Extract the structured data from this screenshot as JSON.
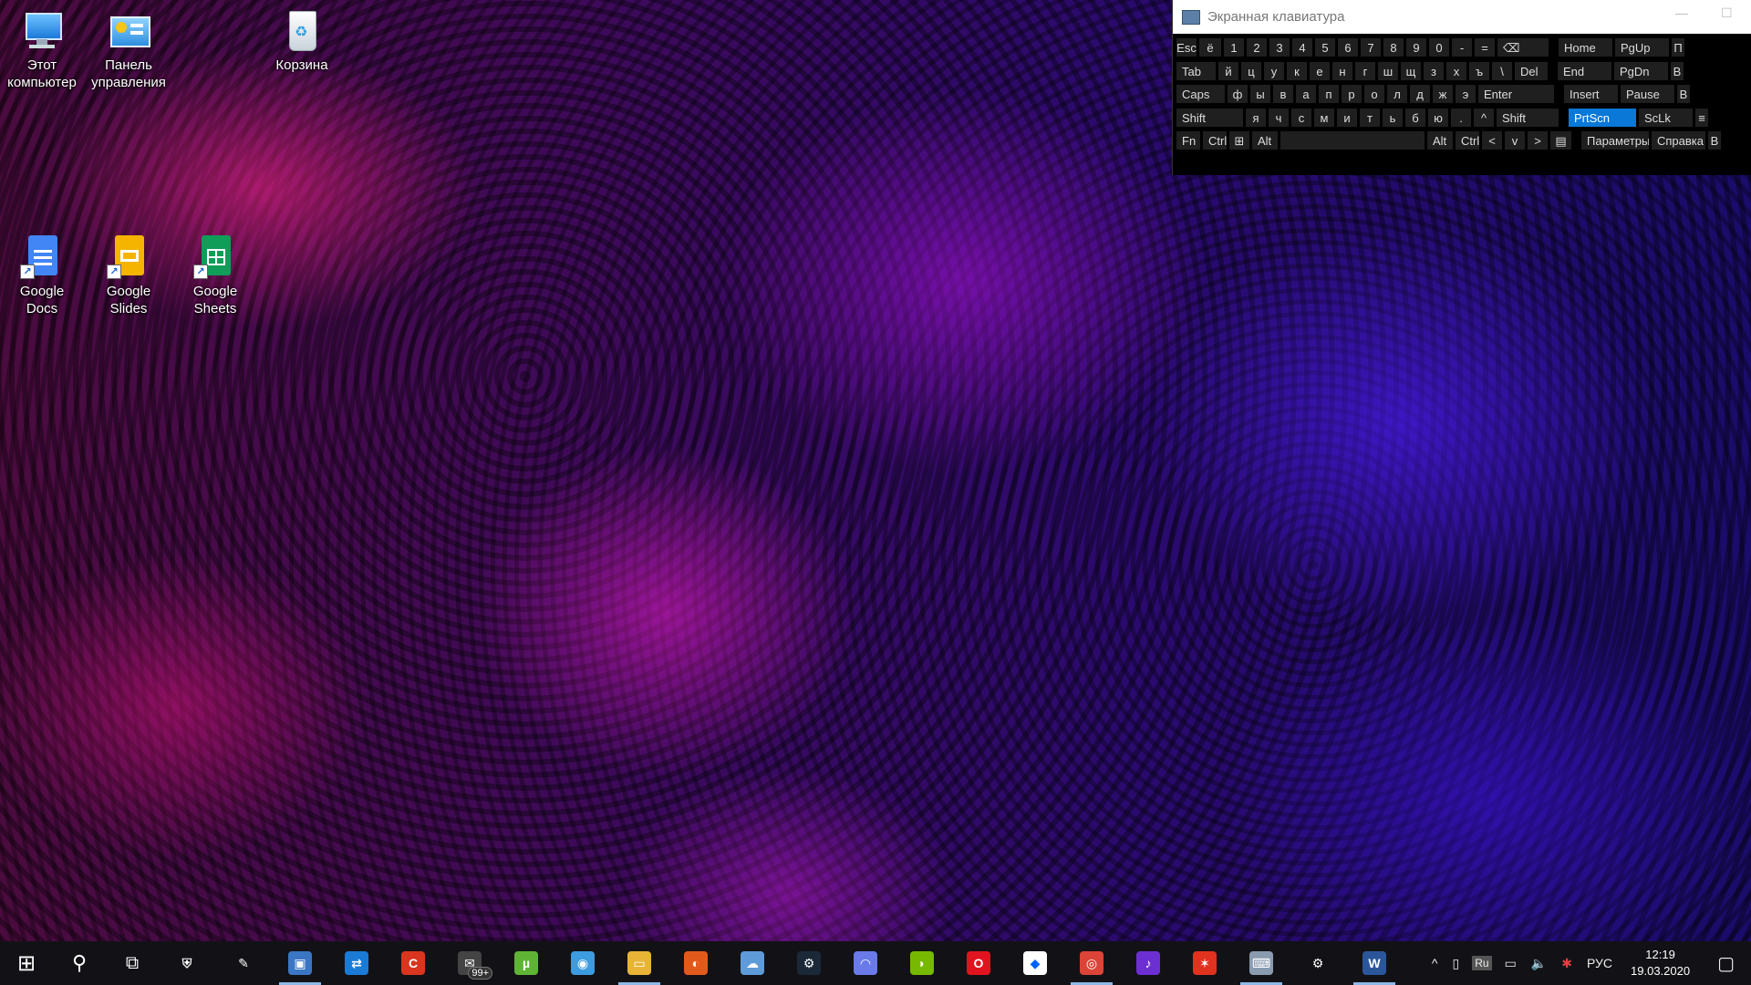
{
  "desktop_icons": [
    {
      "label_line1": "Этот",
      "label_line2": "компьютер",
      "icon": "computer-icon"
    },
    {
      "label_line1": "Панель",
      "label_line2": "управления",
      "icon": "control-panel-icon"
    },
    {
      "label_line1": "Корзина",
      "label_line2": "",
      "icon": "recycle-bin-icon"
    },
    {
      "label_line1": "Google Docs",
      "label_line2": "",
      "icon": "google-docs-icon"
    },
    {
      "label_line1": "Google",
      "label_line2": "Slides",
      "icon": "google-slides-icon"
    },
    {
      "label_line1": "Google",
      "label_line2": "Sheets",
      "icon": "google-sheets-icon"
    }
  ],
  "osk": {
    "title": "Экранная клавиатура",
    "minimize": "—",
    "maximize": "☐",
    "rows": [
      [
        "Esc",
        "ё",
        "1",
        "2",
        "3",
        "4",
        "5",
        "6",
        "7",
        "8",
        "9",
        "0",
        "-",
        "=",
        "⌫",
        "Home",
        "PgUp",
        "П"
      ],
      [
        "Tab",
        "й",
        "ц",
        "у",
        "к",
        "е",
        "н",
        "г",
        "ш",
        "щ",
        "з",
        "х",
        "ъ",
        "\\",
        "Del",
        "End",
        "PgDn",
        "В"
      ],
      [
        "Caps",
        "ф",
        "ы",
        "в",
        "а",
        "п",
        "р",
        "о",
        "л",
        "д",
        "ж",
        "э",
        "Enter",
        "Insert",
        "Pause",
        "В"
      ],
      [
        "Shift",
        "я",
        "ч",
        "с",
        "м",
        "и",
        "т",
        "ь",
        "б",
        "ю",
        ".",
        "^",
        "Shift",
        "PrtScn",
        "ScLk",
        "≡"
      ],
      [
        "Fn",
        "Ctrl",
        "⊞",
        "Alt",
        "",
        "Alt",
        "Ctrl",
        "<",
        "v",
        ">",
        "▤",
        "Параметры",
        "Справка",
        "В"
      ]
    ]
  },
  "taskbar": {
    "start": "⊞",
    "search": "⚲",
    "taskview": "⧉",
    "apps": [
      {
        "name": "windows-security",
        "glyph": "⛨",
        "color": "#121216",
        "running": false
      },
      {
        "name": "feather-app",
        "glyph": "✎",
        "color": "#121216",
        "running": false
      },
      {
        "name": "remote-desktop",
        "glyph": "▣",
        "color": "#3a76c4",
        "running": true
      },
      {
        "name": "teamviewer",
        "glyph": "⇄",
        "color": "#1a7bd6",
        "running": false
      },
      {
        "name": "ccleaner",
        "glyph": "C",
        "color": "#d9351f",
        "running": false
      },
      {
        "name": "mail",
        "glyph": "✉",
        "color": "#444",
        "running": false
      },
      {
        "name": "utorrent",
        "glyph": "µ",
        "color": "#5fb435",
        "running": false
      },
      {
        "name": "blue-orb-app",
        "glyph": "◉",
        "color": "#3d9be0",
        "running": false
      },
      {
        "name": "file-explorer",
        "glyph": "▭",
        "color": "#e8b436",
        "running": true
      },
      {
        "name": "firefox-like",
        "glyph": "◐",
        "color": "#e25a1b",
        "running": false
      },
      {
        "name": "cloud-app",
        "glyph": "☁",
        "color": "#5e9bd8",
        "running": false
      },
      {
        "name": "steam",
        "glyph": "⚙",
        "color": "#1b2838",
        "running": false
      },
      {
        "name": "discord",
        "glyph": "◠",
        "color": "#6a7ae8",
        "running": false
      },
      {
        "name": "nvidia",
        "glyph": "◗",
        "color": "#76b900",
        "running": false
      },
      {
        "name": "opera",
        "glyph": "O",
        "color": "#e0141e",
        "running": false
      },
      {
        "name": "dropbox",
        "glyph": "◆",
        "color": "#fff",
        "running": false
      },
      {
        "name": "chrome",
        "glyph": "◎",
        "color": "#db4437",
        "running": true
      },
      {
        "name": "purple-audio-app",
        "glyph": "♪",
        "color": "#6c2fd1",
        "running": false
      },
      {
        "name": "red-star-app",
        "glyph": "✶",
        "color": "#e0321f",
        "running": false
      },
      {
        "name": "on-screen-keyboard",
        "glyph": "⌨",
        "color": "#8a9bb0",
        "running": true
      },
      {
        "name": "settings",
        "glyph": "⚙",
        "color": "#121216",
        "running": false
      },
      {
        "name": "word",
        "glyph": "W",
        "color": "#2b579a",
        "running": true
      }
    ],
    "mail_badge": "99+",
    "tray_language": "РУС",
    "tray_ru": "Ru",
    "time": "12:19",
    "date": "19.03.2020"
  }
}
